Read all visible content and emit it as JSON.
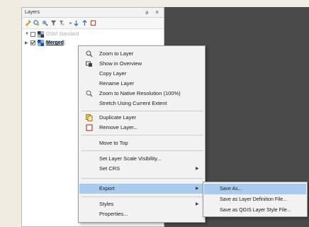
{
  "panel": {
    "title": "Layers",
    "float_glyph": "ə",
    "close_glyph": "×",
    "toolbar": [
      "add-group-icon",
      "manage-map-themes-icon",
      "filter-legend-icon",
      "filter-by-expression-icon",
      "expand-all-icon",
      "collapse-all-icon",
      "remove-layer-icon"
    ],
    "layers": [
      {
        "name": "OSM Standard",
        "checked": false,
        "expanded": true
      },
      {
        "name": "Merged",
        "checked": true,
        "selected": true
      }
    ]
  },
  "menu": {
    "zoom_to_layer": "Zoom to Layer",
    "show_in_overview": "Show in Overview",
    "copy_layer": "Copy Layer",
    "rename_layer": "Rename Layer",
    "zoom_native": "Zoom to Native Resolution (100%)",
    "stretch_extent": "Stretch Using Current Extent",
    "duplicate_layer": "Duplicate Layer",
    "remove_layer": "Remove Layer...",
    "move_to_top": "Move to Top",
    "set_scale_visibility": "Set Layer Scale Visibility...",
    "set_crs": "Set CRS",
    "export": "Export",
    "styles": "Styles",
    "properties": "Properties..."
  },
  "export_submenu": {
    "save_as": "Save As...",
    "save_layer_definition": "Save as Layer Definition File...",
    "save_qgis_style": "Save as QGIS Layer Style File..."
  },
  "colors": {
    "highlight": "#a9cbee",
    "selected_layer": "#cfe1f6",
    "canvas": "#4a4a4a"
  }
}
